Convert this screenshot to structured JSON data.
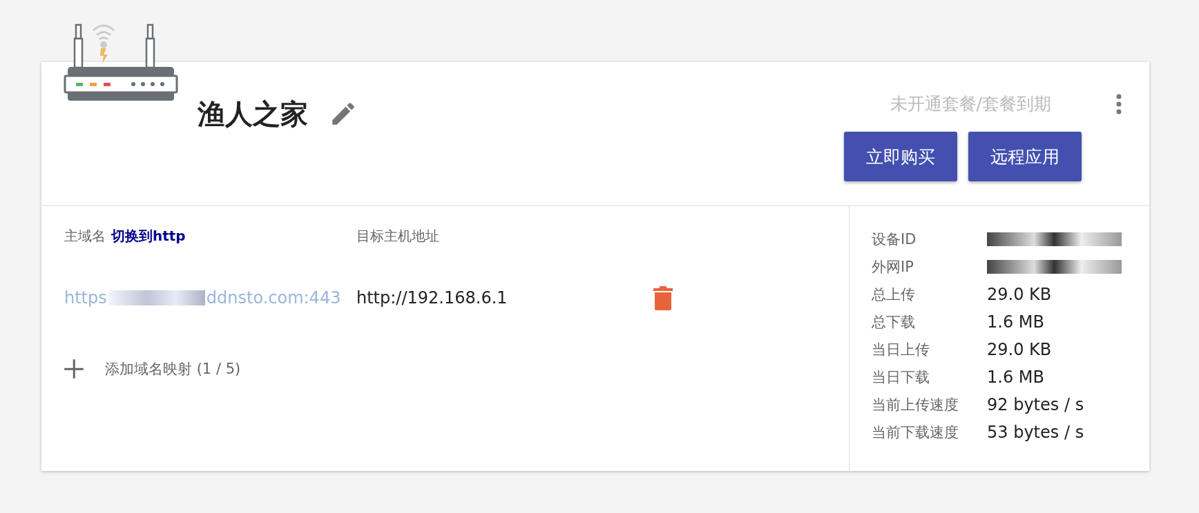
{
  "device": {
    "name": "渔人之家",
    "status": "未开通套餐/套餐到期",
    "buttons": [
      "立即购买",
      "远程应用"
    ]
  },
  "mappings": {
    "columns": [
      "主域名",
      "目标主机地址"
    ],
    "switch_link": "切换到http",
    "rows": [
      {
        "domain_start": "https",
        "domain_redacted": true,
        "domain_end": "ddnsto.com:443",
        "target": "http://192.168.6.1"
      }
    ],
    "add_label": "添加域名映射 (1 / 5)"
  },
  "stats": [
    {
      "label": "设备ID",
      "redacted": true
    },
    {
      "label": "外网IP",
      "redacted": true
    },
    {
      "label": "总上传",
      "value": "29.0 KB"
    },
    {
      "label": "总下载",
      "value": "1.6 MB"
    },
    {
      "label": "当日上传",
      "value": "29.0 KB"
    },
    {
      "label": "当日下载",
      "value": "1.6 MB"
    },
    {
      "label": "当前上传速度",
      "value": "92 bytes / s"
    },
    {
      "label": "当前下载速度",
      "value": "53 bytes / s"
    }
  ]
}
